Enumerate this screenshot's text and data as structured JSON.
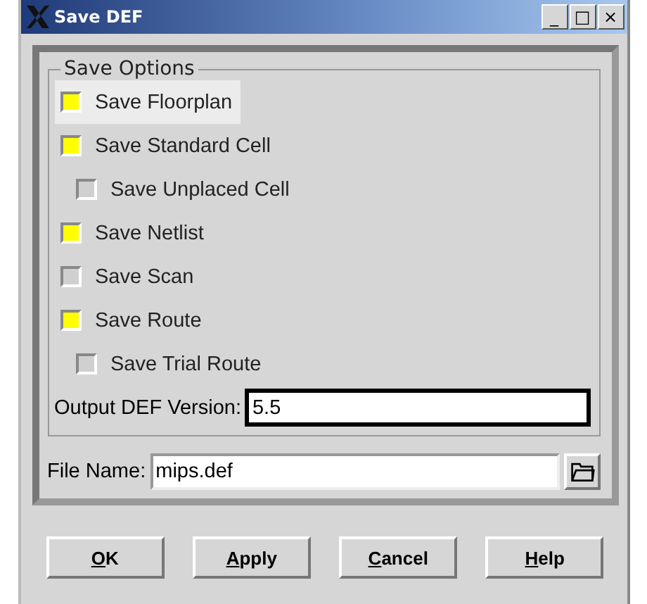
{
  "window": {
    "title": "Save DEF",
    "controls": [
      "_",
      "□",
      "×"
    ]
  },
  "save_options": {
    "title": "Save Options",
    "items": [
      {
        "label": "Save Floorplan",
        "checked": true,
        "focused": true
      },
      {
        "label": "Save Standard Cell",
        "checked": true,
        "focused": false,
        "children": [
          {
            "label": "Save Unplaced Cell",
            "checked": false,
            "focused": false
          }
        ]
      },
      {
        "label": "Save Netlist",
        "checked": true,
        "focused": false
      },
      {
        "label": "Save Scan",
        "checked": false,
        "focused": false
      },
      {
        "label": "Save Route",
        "checked": true,
        "focused": false,
        "children": [
          {
            "label": "Save Trial Route",
            "checked": false,
            "focused": false
          }
        ]
      }
    ],
    "version": {
      "label": "Output DEF Version:",
      "value": "5.5",
      "focused": true
    }
  },
  "file": {
    "label": "File Name:",
    "value": "mips.def"
  },
  "buttons": [
    "OK",
    "Apply",
    "Cancel",
    "Help"
  ]
}
